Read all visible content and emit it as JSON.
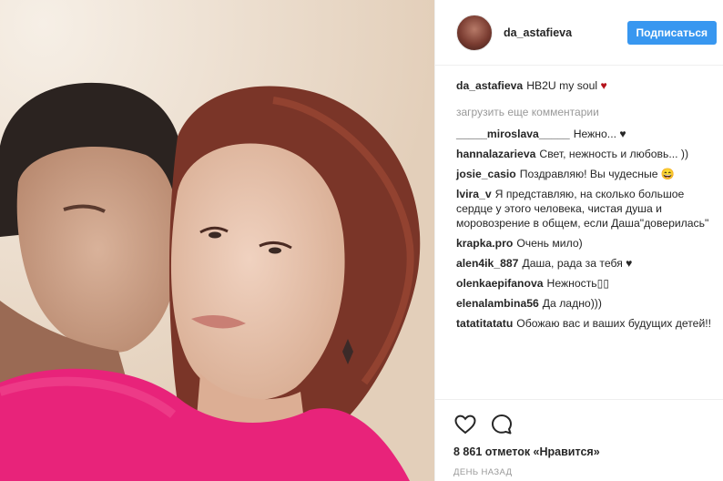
{
  "header": {
    "username": "da_astafieva",
    "follow_label": "Подписаться"
  },
  "caption": {
    "username": "da_astafieva",
    "text": "HB2U my soul",
    "heart": "♥"
  },
  "load_more": "загрузить еще комментарии",
  "comments": [
    {
      "user": "_____miroslava_____",
      "text": "Нежно... ♥"
    },
    {
      "user": "hannalazarieva",
      "text": "Свет, нежность и любовь... ))"
    },
    {
      "user": "josie_casio",
      "text": "Поздравляю! Вы чудесные 😄"
    },
    {
      "user": "lvira_v",
      "text": "Я представляю, на сколько большое сердце у этого человека, чистая душа и моровозрение в общем, если Даша\"доверилась\""
    },
    {
      "user": "krapka.pro",
      "text": "Очень мило)"
    },
    {
      "user": "alen4ik_887",
      "text": "Даша, рада за тебя ♥"
    },
    {
      "user": "olenkaepifanova",
      "text": "Нежность▯▯"
    },
    {
      "user": "elenalambina56",
      "text": "Да ладно)))"
    },
    {
      "user": "tatatitatatu",
      "text": "Обожаю вас и ваших будущих детей!!"
    }
  ],
  "likes": "8 861 отметок «Нравится»",
  "time": "ДЕНЬ НАЗАД",
  "icons": {
    "like": "heart-icon",
    "comment": "comment-icon"
  },
  "colors": {
    "accent": "#3897f0",
    "muted": "#999999",
    "heart": "#b5121b"
  }
}
